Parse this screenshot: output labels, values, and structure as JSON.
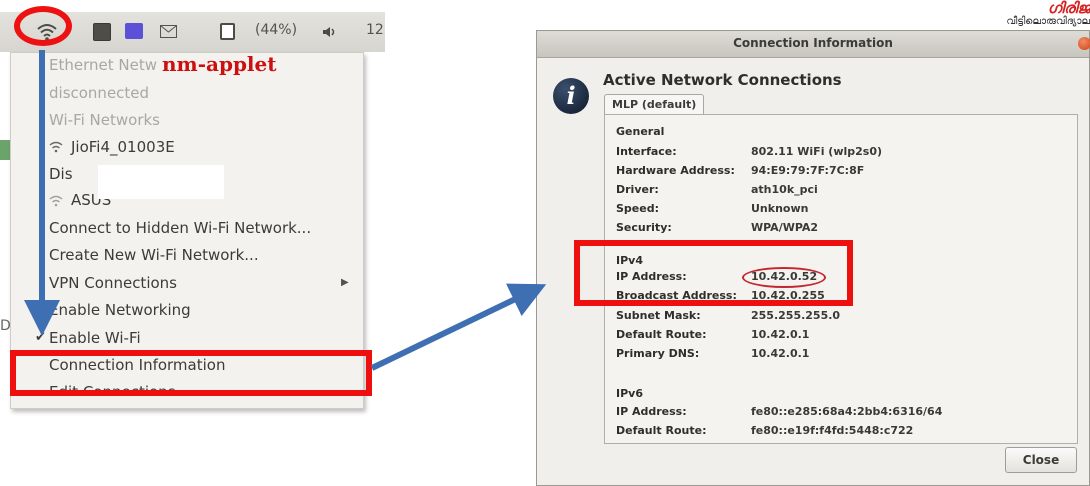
{
  "panel": {
    "battery_text": "(44%)",
    "clock_partial": "12"
  },
  "menu": {
    "ethernet_header": "Ethernet Netw",
    "disconnected": "disconnected",
    "wifi_header": "Wi-Fi Networks",
    "network1": "JioFi4_01003E",
    "network2_partial": "Dis",
    "network3": "ASUS",
    "connect_hidden": "Connect to Hidden Wi-Fi Network...",
    "create_new": "Create New Wi-Fi Network...",
    "vpn": "VPN Connections",
    "enable_networking": "Enable Networking",
    "enable_wifi": "Enable Wi-Fi",
    "connection_info": "Connection Information",
    "edit_connections": "Edit Connections..."
  },
  "behind_window": {
    "letter_d": "D"
  },
  "annotation": {
    "label": "nm-applet",
    "color": "#ee1111",
    "arrow_color": "#3f6fb3"
  },
  "logo": {
    "line1": "ഗിരിജ",
    "line2": "വീട്ടിലൊരുവിദ്യാല"
  },
  "dialog": {
    "title": "Connection Information",
    "heading": "Active Network Connections",
    "tab": "MLP (default)",
    "general": {
      "title": "General",
      "rows": [
        {
          "label": "Interface:",
          "value": "802.11 WiFi (wlp2s0)"
        },
        {
          "label": "Hardware Address:",
          "value": "94:E9:79:7F:7C:8F"
        },
        {
          "label": "Driver:",
          "value": "ath10k_pci"
        },
        {
          "label": "Speed:",
          "value": "Unknown"
        },
        {
          "label": "Security:",
          "value": "WPA/WPA2"
        }
      ]
    },
    "ipv4": {
      "title": "IPv4",
      "rows": [
        {
          "label": "IP Address:",
          "value": "10.42.0.52"
        },
        {
          "label": "Broadcast Address:",
          "value": "10.42.0.255"
        },
        {
          "label": "Subnet Mask:",
          "value": "255.255.255.0"
        },
        {
          "label": "Default Route:",
          "value": "10.42.0.1"
        },
        {
          "label": "Primary DNS:",
          "value": "10.42.0.1"
        }
      ]
    },
    "ipv6": {
      "title": "IPv6",
      "rows": [
        {
          "label": "IP Address:",
          "value": "fe80::e285:68a4:2bb4:6316/64"
        },
        {
          "label": "Default Route:",
          "value": "fe80::e19f:f4fd:5448:c722"
        }
      ]
    },
    "close_button": "Close"
  }
}
